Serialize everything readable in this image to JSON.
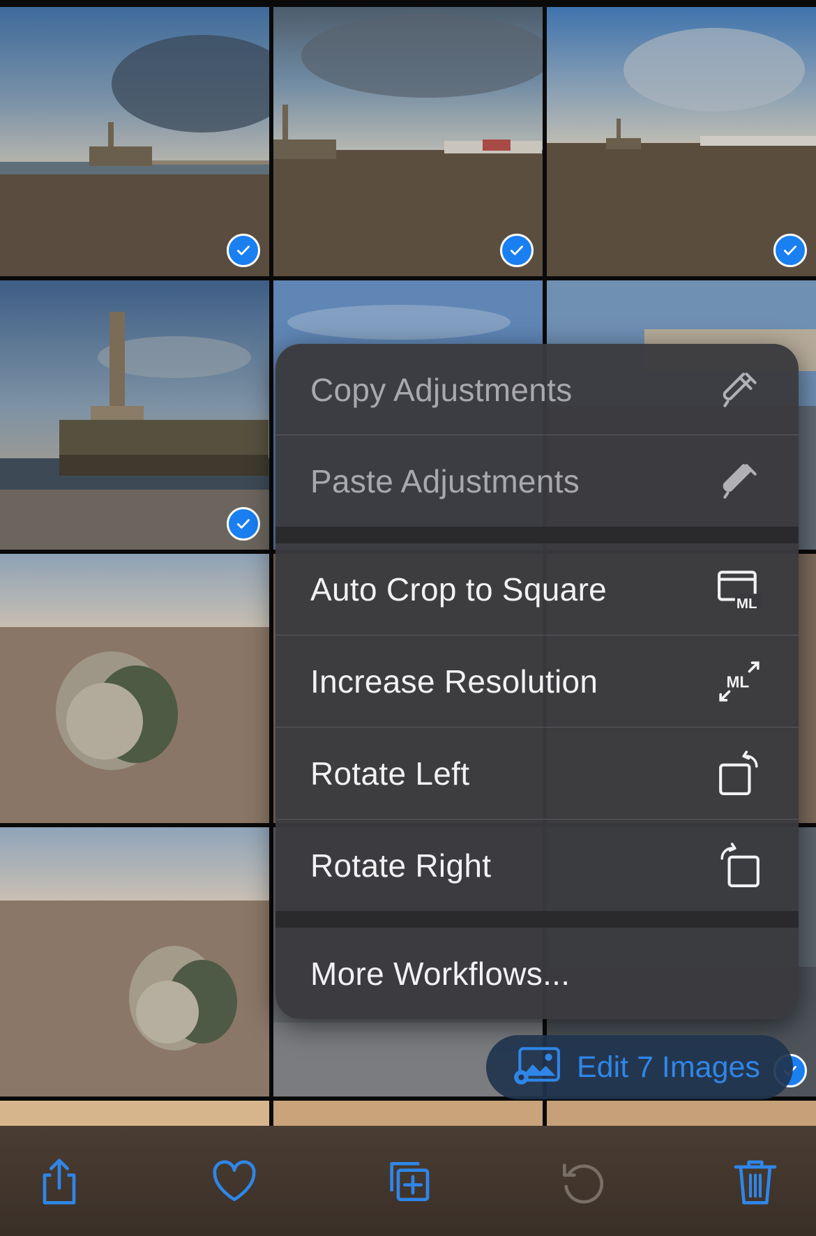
{
  "menu": {
    "items": [
      {
        "label": "Copy Adjustments",
        "icon": "eyedropper-icon",
        "enabled": false
      },
      {
        "label": "Paste Adjustments",
        "icon": "eyedropper-fill-icon",
        "enabled": false
      },
      {
        "label": "Auto Crop to Square",
        "icon": "crop-ml-icon",
        "enabled": true
      },
      {
        "label": "Increase Resolution",
        "icon": "expand-ml-icon",
        "enabled": true
      },
      {
        "label": "Rotate Left",
        "icon": "rotate-left-icon",
        "enabled": true
      },
      {
        "label": "Rotate Right",
        "icon": "rotate-right-icon",
        "enabled": true
      },
      {
        "label": "More Workflows...",
        "icon": "",
        "enabled": true
      }
    ]
  },
  "edit_button": {
    "label": "Edit 7 Images",
    "icon": "photo-gear-icon"
  },
  "grid": {
    "photos": [
      {
        "subject": "lighthouse-beach",
        "selected": true
      },
      {
        "subject": "lighthouse-beach",
        "selected": true
      },
      {
        "subject": "lighthouse-beach",
        "selected": true
      },
      {
        "subject": "lighthouse-pier",
        "selected": true
      },
      {
        "subject": "sky",
        "selected": false
      },
      {
        "subject": "town-seafront",
        "selected": false
      },
      {
        "subject": "oyster-shell",
        "selected": false
      },
      {
        "subject": "beach",
        "selected": false
      },
      {
        "subject": "beach",
        "selected": false
      },
      {
        "subject": "oyster-shell",
        "selected": false
      },
      {
        "subject": "promenade",
        "selected": false
      },
      {
        "subject": "promenade",
        "selected": true
      }
    ]
  },
  "toolbar": {
    "buttons": [
      "share-icon",
      "heart-icon",
      "duplicate-icon",
      "rotate-undo-icon",
      "trash-icon"
    ]
  },
  "colors": {
    "accent": "#2f86e8",
    "menu_bg": "#3a3a3e",
    "toolbar_bg": "#41362d",
    "disabled": "#7a6f66"
  }
}
